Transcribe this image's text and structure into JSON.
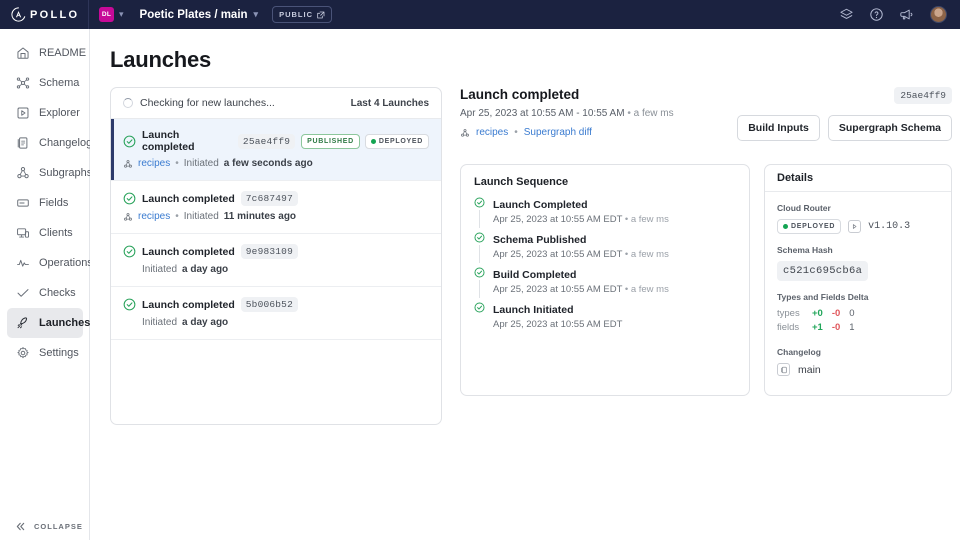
{
  "topbar": {
    "logo_text": "POLLO",
    "org_initials": "DL",
    "graph_title": "Poetic Plates / main",
    "visibility_badge": "PUBLIC",
    "icons": [
      "layers-icon",
      "help-icon",
      "announcement-icon",
      "user-avatar"
    ]
  },
  "sidebar": {
    "items": [
      {
        "label": "README",
        "icon": "readme-icon",
        "active": false
      },
      {
        "label": "Schema",
        "icon": "schema-icon",
        "active": false
      },
      {
        "label": "Explorer",
        "icon": "explorer-icon",
        "active": false
      },
      {
        "label": "Changelog",
        "icon": "changelog-icon",
        "active": false
      },
      {
        "label": "Subgraphs",
        "icon": "subgraphs-icon",
        "active": false
      },
      {
        "label": "Fields",
        "icon": "fields-icon",
        "active": false
      },
      {
        "label": "Clients",
        "icon": "clients-icon",
        "active": false
      },
      {
        "label": "Operations",
        "icon": "operations-icon",
        "active": false
      },
      {
        "label": "Checks",
        "icon": "checks-icon",
        "active": false
      },
      {
        "label": "Launches",
        "icon": "launches-icon",
        "active": true
      },
      {
        "label": "Settings",
        "icon": "settings-icon",
        "active": false
      }
    ],
    "collapse_label": "COLLAPSE"
  },
  "page": {
    "title": "Launches"
  },
  "list": {
    "status_text": "Checking for new launches...",
    "count_label": "Last 4 Launches",
    "rows": [
      {
        "title": "Launch completed",
        "hash": "25ae4ff9",
        "subgraph": "recipes",
        "initiated_label": "Initiated",
        "time": "a few seconds ago",
        "badges": [
          "PUBLISHED",
          "DEPLOYED"
        ],
        "selected": true
      },
      {
        "title": "Launch completed",
        "hash": "7c687497",
        "subgraph": "recipes",
        "initiated_label": "Initiated",
        "time": "11 minutes ago",
        "badges": [],
        "selected": false
      },
      {
        "title": "Launch completed",
        "hash": "9e983109",
        "subgraph": "",
        "initiated_label": "Initiated",
        "time": "a day ago",
        "badges": [],
        "selected": false
      },
      {
        "title": "Launch completed",
        "hash": "5b006b52",
        "subgraph": "",
        "initiated_label": "Initiated",
        "time": "a day ago",
        "badges": [],
        "selected": false
      }
    ]
  },
  "detail": {
    "title": "Launch completed",
    "hash": "25ae4ff9",
    "timestamp": "Apr 25, 2023 at 10:55 AM - 10:55 AM",
    "duration": "a few ms",
    "subgraph_link": "recipes",
    "diff_link": "Supergraph diff",
    "buttons": {
      "build_inputs": "Build Inputs",
      "supergraph_schema": "Supergraph Schema"
    },
    "sequence": {
      "title": "Launch Sequence",
      "steps": [
        {
          "name": "Launch Completed",
          "time": "Apr 25, 2023 at 10:55 AM EDT",
          "duration": "a few ms"
        },
        {
          "name": "Schema Published",
          "time": "Apr 25, 2023 at 10:55 AM EDT",
          "duration": "a few ms"
        },
        {
          "name": "Build Completed",
          "time": "Apr 25, 2023 at 10:55 AM EDT",
          "duration": "a few ms"
        },
        {
          "name": "Launch Initiated",
          "time": "Apr 25, 2023 at 10:55 AM EDT",
          "duration": ""
        }
      ]
    },
    "details": {
      "title": "Details",
      "cloud_router_label": "Cloud Router",
      "cloud_router_status": "DEPLOYED",
      "cloud_router_version": "v1.10.3",
      "schema_hash_label": "Schema Hash",
      "schema_hash": "c521c695cb6a",
      "delta_label": "Types and Fields Delta",
      "delta": [
        {
          "kind": "types",
          "added": "+0",
          "removed": "-0",
          "total": "0"
        },
        {
          "kind": "fields",
          "added": "+1",
          "removed": "-0",
          "total": "1"
        }
      ],
      "changelog_label": "Changelog",
      "changelog_value": "main"
    }
  },
  "colors": {
    "topbar_bg": "#1b2240",
    "accent_blue": "#3a7bd0",
    "success_green": "#13a452",
    "selected_row_bg": "#eef4fc",
    "org_avatar": "#c70a98"
  }
}
